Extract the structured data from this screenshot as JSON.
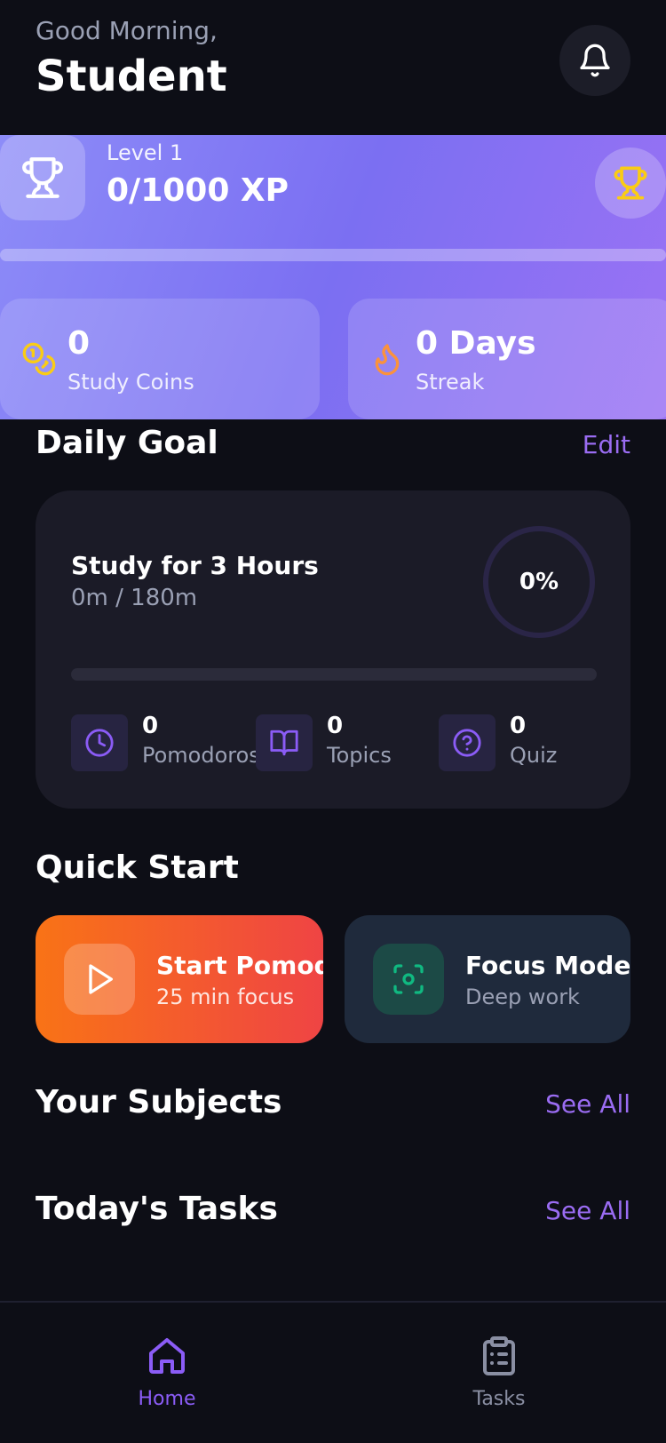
{
  "header": {
    "greeting": "Good Morning,",
    "user_name": "Student",
    "notification_icon": "bell-icon"
  },
  "level_card": {
    "level_label": "Level 1",
    "xp_text": "0/1000 XP",
    "xp_progress_fraction": 0,
    "icon": "trophy-icon",
    "badge_icon": "gold-trophy-icon",
    "gradient_colors": [
      "#8d8cf8",
      "#7b6ff2",
      "#9b72f4"
    ]
  },
  "stats": {
    "coins": {
      "value": "0",
      "label": "Study Coins",
      "icon": "coins-icon",
      "color": "#facc15"
    },
    "streak": {
      "value": "0 Days",
      "label": "Streak",
      "icon": "flame-icon",
      "color": "#fb923c"
    }
  },
  "daily_goal": {
    "title": "Daily Goal",
    "edit_label": "Edit",
    "goal_title": "Study for 3 Hours",
    "goal_progress_text": "0m / 180m",
    "percent_text": "0%",
    "progress_fraction": 0,
    "metrics": [
      {
        "value": "0",
        "label": "Pomodoros",
        "icon": "clock-icon"
      },
      {
        "value": "0",
        "label": "Topics",
        "icon": "book-icon"
      },
      {
        "value": "0",
        "label": "Quiz",
        "icon": "question-icon"
      }
    ]
  },
  "quick_start": {
    "title": "Quick Start",
    "pomodoro": {
      "title": "Start Pomodoro",
      "subtitle": "25 min focus",
      "icon": "play-icon"
    },
    "focus": {
      "title": "Focus Mode",
      "subtitle": "Deep work",
      "icon": "focus-icon"
    }
  },
  "subjects": {
    "title": "Your Subjects",
    "see_all_label": "See All"
  },
  "tasks": {
    "title": "Today's Tasks",
    "see_all_label": "See All"
  },
  "nav": {
    "items": [
      {
        "label": "Home",
        "icon": "home-icon",
        "active": true
      },
      {
        "label": "Tasks",
        "icon": "clipboard-icon",
        "active": false
      }
    ]
  },
  "colors": {
    "accent": "#8b5cf6",
    "background": "#0d0e16",
    "card": "#1b1b27"
  }
}
